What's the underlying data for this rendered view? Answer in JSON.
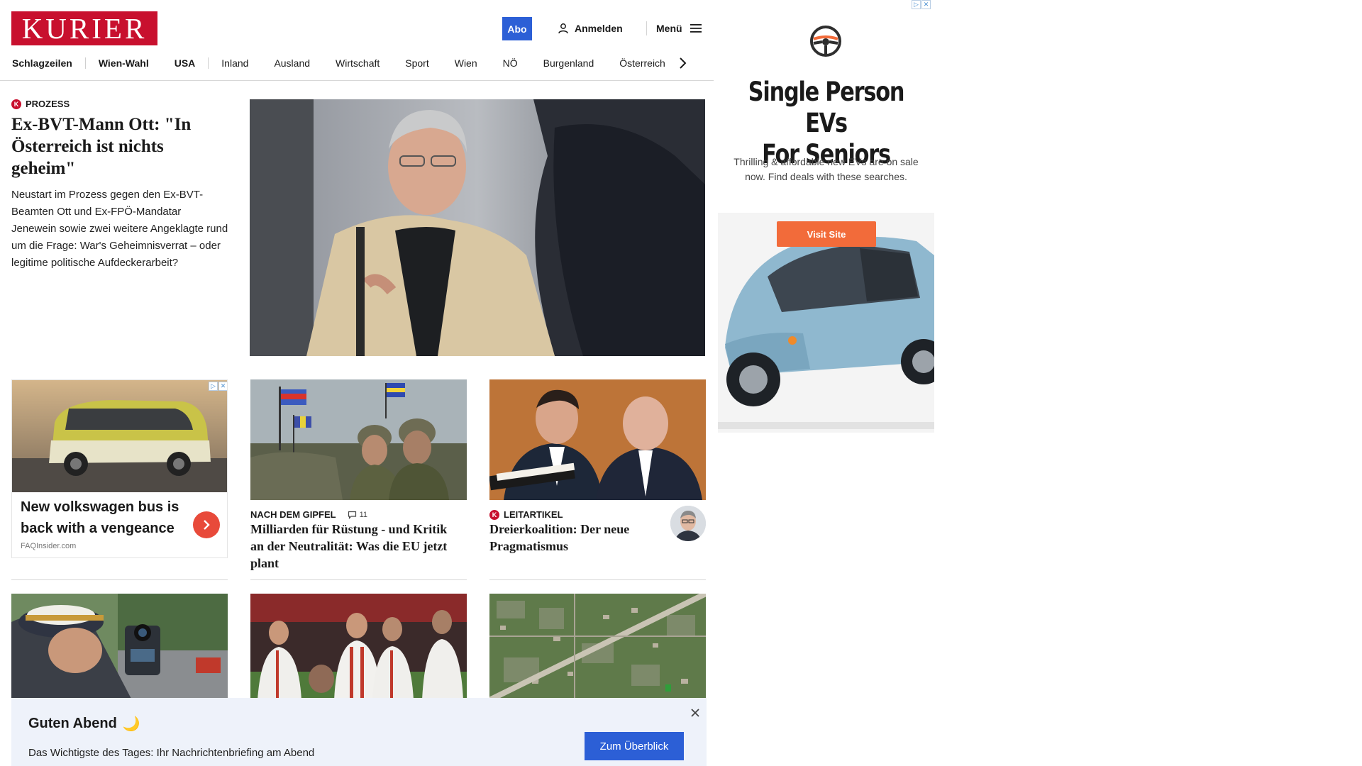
{
  "header": {
    "logo": "KURIER",
    "abo_label": "Abo",
    "login_label": "Anmelden",
    "menu_label": "Menü"
  },
  "nav": {
    "items": [
      "Schlagzeilen",
      "Wien-Wahl",
      "USA",
      "Inland",
      "Ausland",
      "Wirtschaft",
      "Sport",
      "Wien",
      "NÖ",
      "Burgenland",
      "Österreich"
    ]
  },
  "lead": {
    "kicker": "Prozess",
    "badge": "K",
    "title": "Ex-BVT-Mann Ott: \"In Österreich ist nichts geheim\"",
    "teaser": "Neustart im Prozess gegen den Ex-BVT-Beamten Ott und Ex-FPÖ-Mandatar Jenewein sowie zwei weitere Angeklagte rund um die Frage: War's Geheimnisverrat – oder legitime politische Aufdeckerarbeit?"
  },
  "inline_ad": {
    "headline": "New volkswagen bus is back with a vengeance",
    "source": "FAQInsider.com"
  },
  "cards": [
    {
      "kicker": "Nach dem Gipfel",
      "comments": "11",
      "title": "Milliarden für Rüstung - und Kritik an der Neutralität: Was die EU jetzt plant"
    },
    {
      "kicker": "Leitartikel",
      "badge": "K",
      "title": "Dreierkoalition: Der neue Pragmatismus"
    }
  ],
  "notification": {
    "title": "Guten Abend",
    "emoji": "🌙",
    "text": "Das Wichtigste des Tages: Ihr Nachrichtenbriefing am Abend",
    "button": "Zum Überblick"
  },
  "side_ad": {
    "headline_line1": "Single Person EVs",
    "headline_line2": "For Seniors",
    "subtext": "Thrilling & affordable new EVs are on sale now. Find deals with these searches.",
    "button": "Visit Site"
  },
  "colors": {
    "brand_red": "#c8102e",
    "accent_blue": "#2c5fd6",
    "ad_orange": "#f26b3a",
    "notify_bg": "#eef2fa"
  }
}
